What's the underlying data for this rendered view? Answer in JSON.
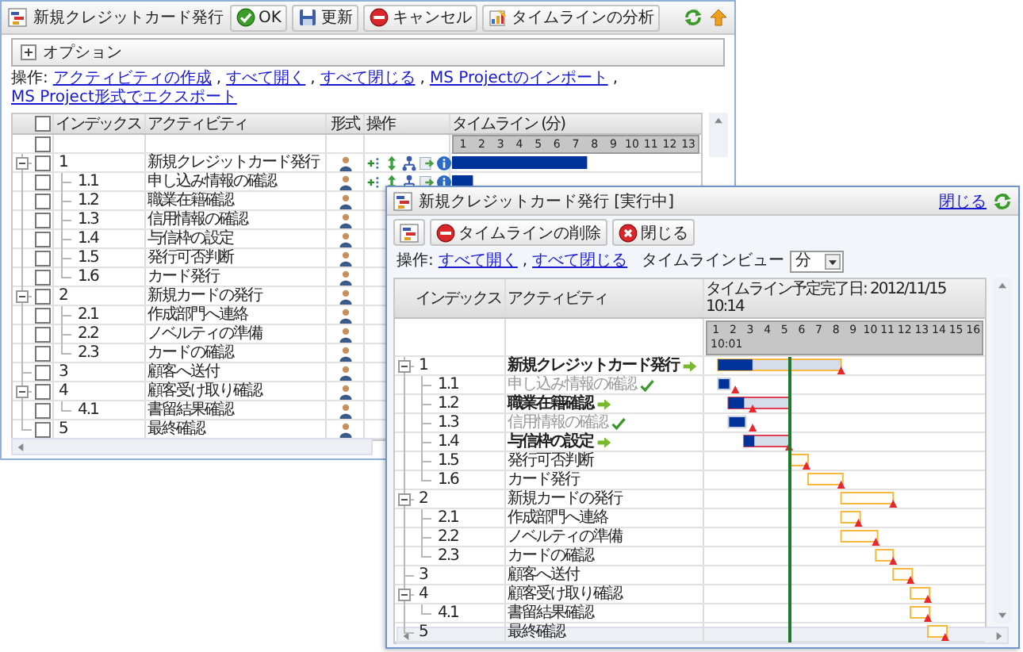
{
  "left_window": {
    "title": "新規クレジットカード発行",
    "toolbar": [
      {
        "kind": "ok",
        "label": "OK"
      },
      {
        "kind": "refresh",
        "label": "更新"
      },
      {
        "kind": "cancel",
        "label": "キャンセル"
      },
      {
        "kind": "analyze",
        "label": "タイムラインの分析"
      }
    ],
    "options": {
      "label": "オプション",
      "expanded": false
    },
    "actions": {
      "label": "操作:",
      "separator": ",",
      "links": [
        "アクティビティの作成",
        "すべて開く",
        "すべて閉じる",
        "MS Projectのインポート",
        "MS Project形式でエクスポート"
      ]
    },
    "table": {
      "columns": [
        "インデックス",
        "アクティビティ",
        "形式",
        "操作",
        "タイムライン (分)"
      ],
      "header_checked": false,
      "scale_row_checked": false,
      "scale": [
        "1",
        "2",
        "3",
        "4",
        "5",
        "6",
        "7",
        "8",
        "9",
        "10",
        "11",
        "12",
        "13"
      ],
      "rows": [
        {
          "index": "1",
          "activity": "新規クレジットカード発行",
          "checked": false,
          "expanded": true,
          "children": [
            {
              "index": "1.1",
              "activity": "申し込み情報の確認",
              "checked": false
            },
            {
              "index": "1.2",
              "activity": "職業在籍確認",
              "checked": false
            },
            {
              "index": "1.3",
              "activity": "信用情報の確認",
              "checked": false
            },
            {
              "index": "1.4",
              "activity": "与信枠の設定",
              "checked": false
            },
            {
              "index": "1.5",
              "activity": "発行可否判断",
              "checked": false
            },
            {
              "index": "1.6",
              "activity": "カード発行",
              "checked": false
            }
          ]
        },
        {
          "index": "2",
          "activity": "新規カードの発行",
          "checked": false,
          "expanded": true,
          "children": [
            {
              "index": "2.1",
              "activity": "作成部門へ連絡",
              "checked": false
            },
            {
              "index": "2.2",
              "activity": "ノベルティの準備",
              "checked": false
            },
            {
              "index": "2.3",
              "activity": "カードの確認",
              "checked": false
            }
          ]
        },
        {
          "index": "3",
          "activity": "顧客へ送付",
          "checked": false
        },
        {
          "index": "4",
          "activity": "顧客受け取り確認",
          "checked": false,
          "expanded": true,
          "children": [
            {
              "index": "4.1",
              "activity": "書留結果確認",
              "checked": false
            }
          ]
        },
        {
          "index": "5",
          "activity": "最終確認",
          "checked": false
        }
      ]
    }
  },
  "right_window": {
    "title": "新規クレジットカード発行 [実行中]",
    "close_link": "閉じる",
    "toolbar": [
      {
        "kind": "layout"
      },
      {
        "kind": "delete",
        "label": "タイムラインの削除"
      },
      {
        "kind": "close",
        "label": "閉じる"
      }
    ],
    "actions": {
      "label": "操作:",
      "separator": ",",
      "links": [
        "すべて開く",
        "すべて閉じる"
      ],
      "view_label": "タイムラインビュー",
      "view_value": "分"
    },
    "table": {
      "columns": [
        "インデックス",
        "アクティビティ",
        "タイムライン予定完了日: 2012/11/15 10:14"
      ],
      "scale": [
        "1",
        "2",
        "3",
        "4",
        "5",
        "6",
        "7",
        "8",
        "9",
        "10",
        "11",
        "12",
        "13",
        "14",
        "15",
        "16"
      ],
      "scale_start": "10:01",
      "rows": [
        {
          "index": "1",
          "activity": "新規クレジットカード発行",
          "kind": "running",
          "late": false,
          "level": 0.28,
          "expanded": true,
          "children": [
            {
              "index": "1.1",
              "activity": "申し込み情報の確認",
              "kind": "done",
              "late": false,
              "level": 1
            },
            {
              "index": "1.2",
              "activity": "職業在籍確認",
              "kind": "running",
              "late": true,
              "level": 0.26
            },
            {
              "index": "1.3",
              "activity": "信用情報の確認",
              "kind": "done",
              "late": false,
              "level": 1
            },
            {
              "index": "1.4",
              "activity": "与信枠の設定",
              "kind": "running",
              "late": true,
              "level": 0.23
            },
            {
              "index": "1.5",
              "activity": "発行可否判断",
              "kind": "pending",
              "late": false
            },
            {
              "index": "1.6",
              "activity": "カード発行",
              "kind": "pending",
              "late": false
            }
          ]
        },
        {
          "index": "2",
          "activity": "新規カードの発行",
          "kind": "pending",
          "late": false,
          "expanded": true,
          "children": [
            {
              "index": "2.1",
              "activity": "作成部門へ連絡",
              "kind": "pending",
              "late": false
            },
            {
              "index": "2.2",
              "activity": "ノベルティの準備",
              "kind": "pending",
              "late": false
            },
            {
              "index": "2.3",
              "activity": "カードの確認",
              "kind": "pending",
              "late": false
            }
          ]
        },
        {
          "index": "3",
          "activity": "顧客へ送付",
          "kind": "pending",
          "late": false
        },
        {
          "index": "4",
          "activity": "顧客受け取り確認",
          "kind": "pending",
          "late": false,
          "expanded": true,
          "children": [
            {
              "index": "4.1",
              "activity": "書留結果確認",
              "kind": "pending",
              "late": false
            }
          ]
        },
        {
          "index": "5",
          "activity": "最終確認",
          "kind": "pending",
          "late": false
        }
      ]
    }
  }
}
